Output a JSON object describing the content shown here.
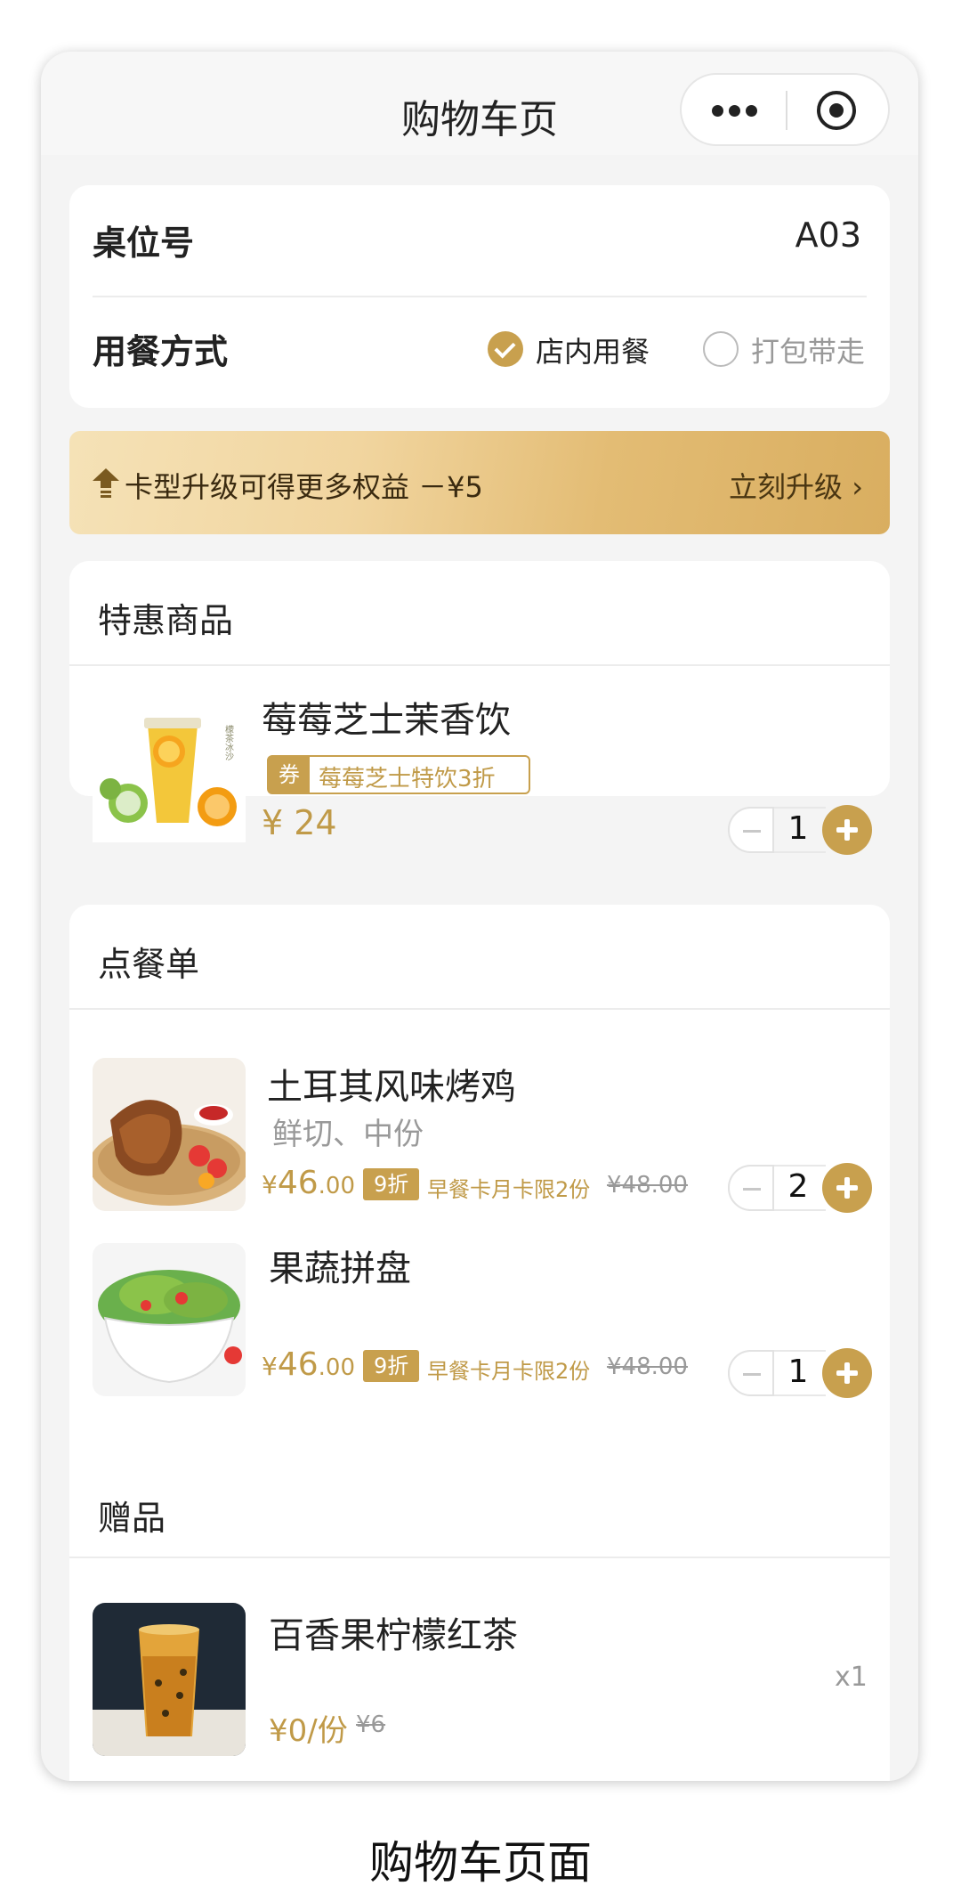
{
  "nav": {
    "title": "购物车页"
  },
  "table": {
    "label": "桌位号",
    "value": "A03",
    "dining_label": "用餐方式",
    "options": [
      {
        "label": "店内用餐",
        "selected": true
      },
      {
        "label": "打包带走",
        "selected": false
      }
    ]
  },
  "banner": {
    "text": "卡型升级可得更多权益 －¥5",
    "link": "立刻升级 ›"
  },
  "special": {
    "title": "特惠商品",
    "item": {
      "name": "莓莓芝士茉香饮",
      "coupon_badge": "券",
      "coupon_text": "莓莓芝士特饮3折",
      "price": "¥ 24",
      "qty": "1"
    }
  },
  "order": {
    "title": "点餐单",
    "items": [
      {
        "name": "土耳其风味烤鸡",
        "spec": "鲜切、中份",
        "price_yen": "¥",
        "price_int": "46",
        "price_dec": ".00",
        "discount": "9折",
        "limit": "早餐卡月卡限2份",
        "old_price": "¥48.00",
        "qty": "2"
      },
      {
        "name": "果蔬拼盘",
        "spec": "",
        "price_yen": "¥",
        "price_int": "46",
        "price_dec": ".00",
        "discount": "9折",
        "limit": "早餐卡月卡限2份",
        "old_price": "¥48.00",
        "qty": "1"
      }
    ]
  },
  "gift": {
    "title": "赠品",
    "item": {
      "name": "百香果柠檬红茶",
      "price": "¥0/份",
      "old_price": "¥6",
      "qty": "x1"
    }
  },
  "caption": "购物车页面",
  "colors": {
    "accent": "#c8a04e",
    "price": "#c09a48",
    "banner_start": "#f5e2b7",
    "banner_end": "#d9ae60"
  },
  "icons": [
    "more-dots-icon",
    "target-icon",
    "check-icon",
    "upgrade-arrow-icon",
    "minus-icon",
    "plus-icon"
  ]
}
